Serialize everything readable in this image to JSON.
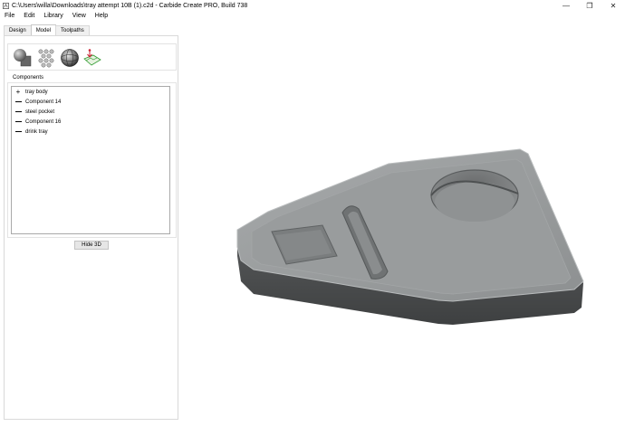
{
  "window": {
    "title": "C:\\Users\\willa\\Downloads\\tray attempt 10B (1).c2d - Carbide Create PRO, Build 738",
    "minimize": "—",
    "maximize": "❐",
    "close": "✕"
  },
  "menu": [
    "File",
    "Edit",
    "Library",
    "View",
    "Help"
  ],
  "tabs": [
    {
      "label": "Design",
      "active": false
    },
    {
      "label": "Model",
      "active": true
    },
    {
      "label": "Toolpaths",
      "active": false
    }
  ],
  "tools": [
    "shapes-tool-icon",
    "texture-tool-icon",
    "sphere-tool-icon",
    "image-import-icon"
  ],
  "components_label": "Components",
  "components": [
    {
      "label": "tray body",
      "glyph": "plus"
    },
    {
      "label": "Component 14",
      "glyph": "dash"
    },
    {
      "label": "steel pocket",
      "glyph": "dash"
    },
    {
      "label": "Component 16",
      "glyph": "dash"
    },
    {
      "label": "drink tray",
      "glyph": "dash"
    }
  ],
  "hide3d_label": "Hide 3D",
  "colors": {
    "model_top": "#9a9d9e",
    "model_side": "#5a5c5d",
    "panel_border": "#d9d9d9"
  }
}
